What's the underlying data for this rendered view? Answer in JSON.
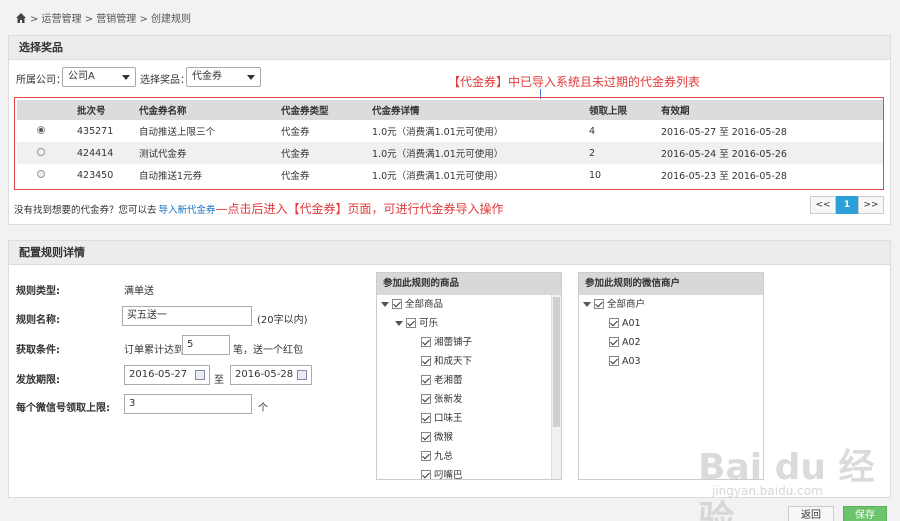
{
  "breadcrumb": {
    "home_icon": "home-icon",
    "text": "> 运营管理 > 营销管理 > 创建规则"
  },
  "prize_panel": {
    "title": "选择奖品",
    "company_label": "所属公司：",
    "company_value": "公司A",
    "prize_label": "选择奖品：",
    "prize_value": "代金券",
    "annotation": "【代金券】中已导入系统且未过期的代金券列表"
  },
  "voucher_table": {
    "headers": [
      "",
      "批次号",
      "代金券名称",
      "代金券类型",
      "代金券详情",
      "领取上限",
      "有效期"
    ],
    "rows": [
      {
        "selected": true,
        "batch": "435271",
        "name": "自动推送上限三个",
        "type": "代金券",
        "detail": "1.0元（消费满1.01元可使用）",
        "limit": "4",
        "validity": "2016-05-27 至 2016-05-28"
      },
      {
        "selected": false,
        "batch": "424414",
        "name": "测试代金券",
        "type": "代金券",
        "detail": "1.0元（消费满1.01元可使用）",
        "limit": "2",
        "validity": "2016-05-24 至 2016-05-26"
      },
      {
        "selected": false,
        "batch": "423450",
        "name": "自动推送1元券",
        "type": "代金券",
        "detail": "1.0元（消费满1.01元可使用）",
        "limit": "10",
        "validity": "2016-05-23 至 2016-05-28"
      }
    ]
  },
  "import_hint": {
    "prefix": "没有找到想要的代金券？您可以去",
    "link": "导入新代金券",
    "annotation": "—点击后进入【代金券】页面，可进行代金券导入操作"
  },
  "pagination": {
    "prev": "<<",
    "current": "1",
    "next": ">>"
  },
  "rule_panel": {
    "title": "配置规则详情",
    "type_label": "规则类型:",
    "type_value": "满单送",
    "name_label": "规则名称:",
    "name_value": "买五送一",
    "name_hint": "(20字以内)",
    "condition_label": "获取条件:",
    "condition_prefix": "订单累计达到",
    "condition_value": "5",
    "condition_suffix": "笔，送一个红包",
    "period_label": "发放期限:",
    "start_date": "2016-05-27",
    "to": "至",
    "end_date": "2016-05-28",
    "limit_label": "每个微信号领取上限:",
    "limit_value": "3",
    "limit_unit": "个"
  },
  "goods_tree": {
    "title": "参加此规则的商品",
    "root": "全部商品",
    "group": "可乐",
    "items": [
      "湘蕾铺子",
      "和成天下",
      "老湘蕾",
      "张新发",
      "口味王",
      "微猴",
      "九总",
      "叼嘴巴"
    ]
  },
  "merchant_tree": {
    "title": "参加此规则的微信商户",
    "root": "全部商户",
    "items": [
      "A01",
      "A02",
      "A03"
    ]
  },
  "actions": {
    "back": "返回",
    "save": "保存"
  },
  "watermark": {
    "logo": "Bai du 经验",
    "url": "jingyan.baidu.com"
  },
  "colors": {
    "annotation_red": "#e03a3a",
    "link_blue": "#1a6fc0",
    "accent_blue": "#2a9fd8",
    "save_green": "#6cc36c"
  }
}
